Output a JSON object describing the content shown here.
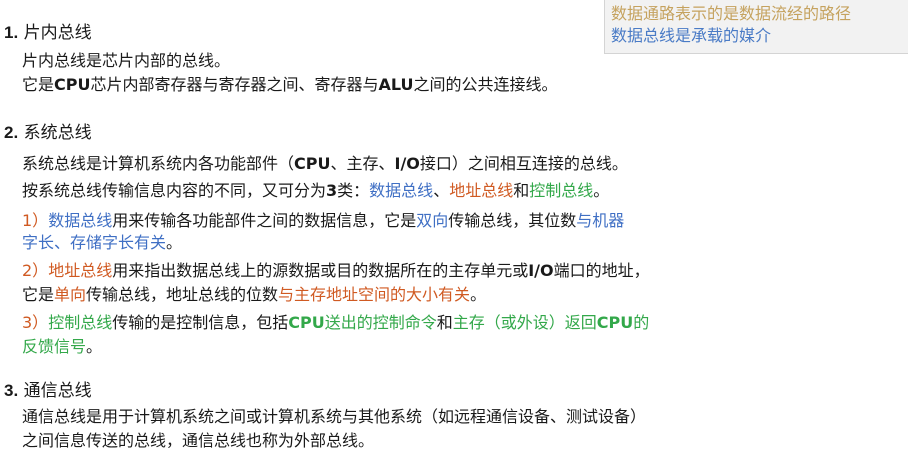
{
  "note": {
    "line1": "数据通路表示的是数据流经的路径",
    "line2": "数据总线是承载的媒介"
  },
  "section1": {
    "num": "1.",
    "title": "片内总线",
    "line1": "片内总线是芯片内部的总线。",
    "line2": {
      "a": "它是",
      "b": "CPU",
      "c": "芯片内部寄存器与寄存器之间、寄存器与",
      "d": "ALU",
      "e": "之间的公共连接线。"
    }
  },
  "section2": {
    "num": "2.",
    "title": "系统总线",
    "line1": {
      "a": "系统总线是计算机系统内各功能部件（",
      "b": "CPU",
      "c": "、主存、",
      "d": "I/O",
      "e": "接口）之间相互连接的总线。"
    },
    "line2": {
      "a": "按系统总线传输信息内容的不同，又可分为",
      "b": "3",
      "c": "类：",
      "d": "数据总线",
      "e": "、",
      "f": "地址总线",
      "g": "和",
      "h": "控制总线",
      "i": "。"
    },
    "item1": {
      "a": "1）",
      "b": "数据总线",
      "c": "用来传输各功能部件之间的数据信息，它是",
      "d": "双向",
      "e": "传输总线，其位数",
      "f": "与机器",
      "g": "字长、存储字长有关",
      "h": "。"
    },
    "item2": {
      "a": "2）",
      "b": "地址总线",
      "c": "用来指出数据总线上的源数据或目的数据所在的主存单元或",
      "d": "I/O",
      "e": "端口的地址，",
      "f": "它是",
      "g": "单向",
      "h": "传输总线，地址总线的位数",
      "i": "与主存地址空间的大小有关",
      "j": "。"
    },
    "item3": {
      "a": "3）",
      "b": "控制总线",
      "c": "传输的是控制信息，包括",
      "d": "CPU",
      "e": "送出的控制命令",
      "f": "和",
      "g": "主存（或外设）返回",
      "h": "CPU",
      "i": "的",
      "j": "反馈信号",
      "k": "。"
    }
  },
  "section3": {
    "num": "3.",
    "title": "通信总线",
    "line1": "通信总线是用于计算机系统之间或计算机系统与其他系统（如远程通信设备、测试设备）",
    "line2": "之间信息传送的总线，通信总线也称为外部总线。"
  }
}
